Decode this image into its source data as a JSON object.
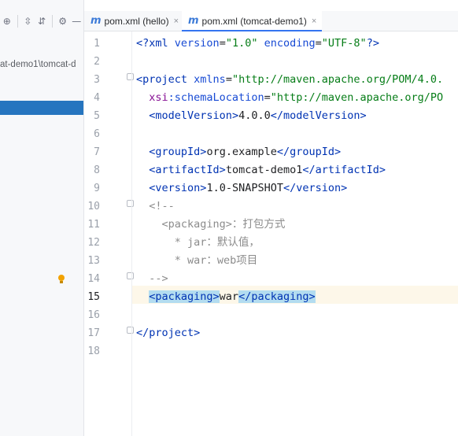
{
  "left_panel": {
    "toolbar": {
      "icons": [
        "target-icon",
        "expand-all-icon",
        "collapse-all-icon",
        "gear-icon",
        "minimize-icon"
      ],
      "glyphs": [
        "⊕",
        "⇳",
        "⇵",
        "⚙",
        "—"
      ]
    },
    "path_text": "at-demo1\\tomcat-d"
  },
  "tabs": [
    {
      "icon": "m",
      "label": "pom.xml (hello)",
      "close": "×",
      "active": false
    },
    {
      "icon": "m",
      "label": "pom.xml (tomcat-demo1)",
      "close": "×",
      "active": true
    }
  ],
  "editor": {
    "current_line": 15,
    "lines": [
      {
        "num": "1",
        "parts": [
          {
            "t": "<?",
            "c": "tag"
          },
          {
            "t": "xml ",
            "c": "tag"
          },
          {
            "t": "version",
            "c": "attr"
          },
          {
            "t": "=",
            "c": ""
          },
          {
            "t": "\"1.0\"",
            "c": "str"
          },
          {
            "t": " ",
            "c": ""
          },
          {
            "t": "encoding",
            "c": "attr"
          },
          {
            "t": "=",
            "c": ""
          },
          {
            "t": "\"UTF-8\"",
            "c": "str"
          },
          {
            "t": "?>",
            "c": "tag"
          }
        ]
      },
      {
        "num": "2",
        "parts": []
      },
      {
        "num": "3",
        "parts": [
          {
            "t": "<",
            "c": "tag"
          },
          {
            "t": "project ",
            "c": "tag"
          },
          {
            "t": "xmlns",
            "c": "attr"
          },
          {
            "t": "=",
            "c": ""
          },
          {
            "t": "\"http://maven.apache.org/POM/4.0.",
            "c": "str"
          }
        ]
      },
      {
        "num": "4",
        "parts": [
          {
            "t": "  ",
            "c": ""
          },
          {
            "t": "xsi",
            "c": "ns"
          },
          {
            "t": ":schemaLocation",
            "c": "attr"
          },
          {
            "t": "=",
            "c": ""
          },
          {
            "t": "\"http://maven.apache.org/PO",
            "c": "str"
          }
        ]
      },
      {
        "num": "5",
        "parts": [
          {
            "t": "  <",
            "c": "tag"
          },
          {
            "t": "modelVersion",
            "c": "tag"
          },
          {
            "t": ">",
            "c": "tag"
          },
          {
            "t": "4.0.0",
            "c": ""
          },
          {
            "t": "</",
            "c": "tag"
          },
          {
            "t": "modelVersion",
            "c": "tag"
          },
          {
            "t": ">",
            "c": "tag"
          }
        ]
      },
      {
        "num": "6",
        "parts": []
      },
      {
        "num": "7",
        "parts": [
          {
            "t": "  <",
            "c": "tag"
          },
          {
            "t": "groupId",
            "c": "tag"
          },
          {
            "t": ">",
            "c": "tag"
          },
          {
            "t": "org.example",
            "c": ""
          },
          {
            "t": "</",
            "c": "tag"
          },
          {
            "t": "groupId",
            "c": "tag"
          },
          {
            "t": ">",
            "c": "tag"
          }
        ]
      },
      {
        "num": "8",
        "parts": [
          {
            "t": "  <",
            "c": "tag"
          },
          {
            "t": "artifactId",
            "c": "tag"
          },
          {
            "t": ">",
            "c": "tag"
          },
          {
            "t": "tomcat-demo1",
            "c": ""
          },
          {
            "t": "</",
            "c": "tag"
          },
          {
            "t": "artifactId",
            "c": "tag"
          },
          {
            "t": ">",
            "c": "tag"
          }
        ]
      },
      {
        "num": "9",
        "parts": [
          {
            "t": "  <",
            "c": "tag"
          },
          {
            "t": "version",
            "c": "tag"
          },
          {
            "t": ">",
            "c": "tag"
          },
          {
            "t": "1.0-SNAPSHOT",
            "c": ""
          },
          {
            "t": "</",
            "c": "tag"
          },
          {
            "t": "version",
            "c": "tag"
          },
          {
            "t": ">",
            "c": "tag"
          }
        ]
      },
      {
        "num": "10",
        "parts": [
          {
            "t": "  <!--",
            "c": "cmt"
          }
        ]
      },
      {
        "num": "11",
        "parts": [
          {
            "t": "    <packaging>：打包方式",
            "c": "cmt"
          }
        ]
      },
      {
        "num": "12",
        "parts": [
          {
            "t": "      * jar：默认值，",
            "c": "cmt"
          }
        ]
      },
      {
        "num": "13",
        "parts": [
          {
            "t": "      * war：web项目",
            "c": "cmt"
          }
        ]
      },
      {
        "num": "14",
        "parts": [
          {
            "t": "  -->",
            "c": "cmt"
          }
        ]
      },
      {
        "num": "15",
        "parts": [
          {
            "t": "  ",
            "c": ""
          },
          {
            "t": "<packaging>",
            "c": "tag hl"
          },
          {
            "t": "war",
            "c": ""
          },
          {
            "t": "</packaging>",
            "c": "tag hl"
          }
        ]
      },
      {
        "num": "16",
        "parts": []
      },
      {
        "num": "17",
        "parts": [
          {
            "t": "</",
            "c": "tag"
          },
          {
            "t": "project",
            "c": "tag"
          },
          {
            "t": ">",
            "c": "tag"
          }
        ]
      },
      {
        "num": "18",
        "parts": []
      }
    ]
  },
  "colors": {
    "selection": "#2675bf",
    "tag": "#0033b3",
    "string": "#067d17",
    "comment": "#8c8c8c",
    "tag_highlight": "#b3dcf0",
    "current_line": "#fdf7e9"
  }
}
